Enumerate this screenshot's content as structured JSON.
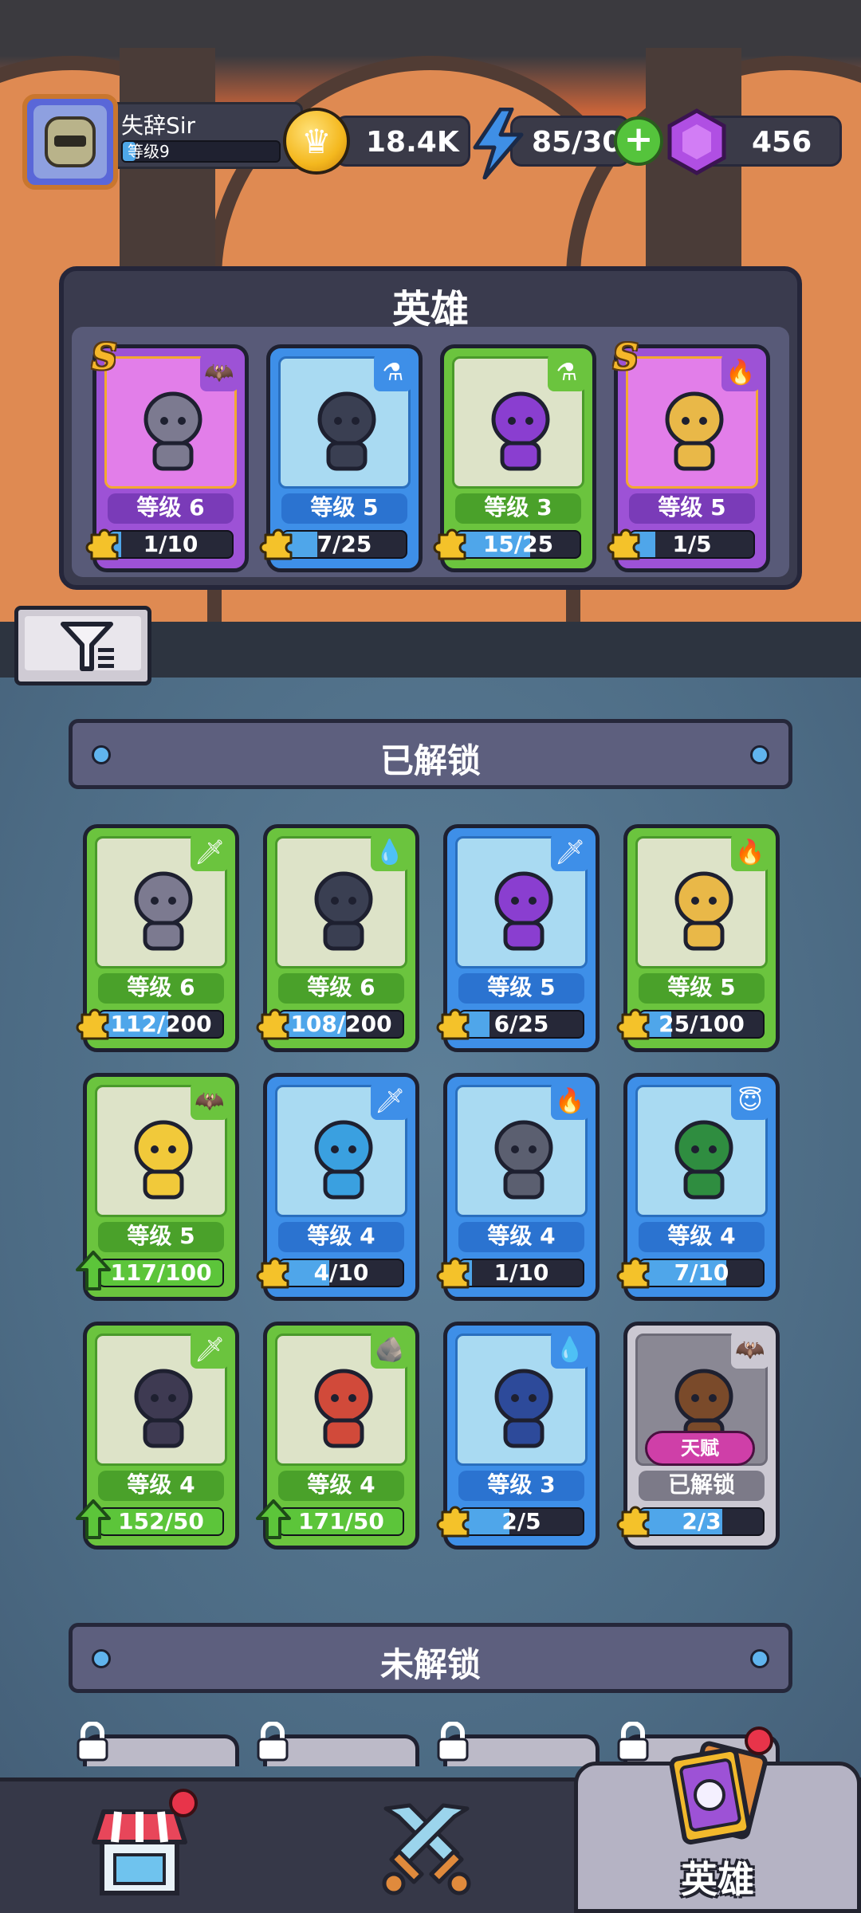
{
  "player": {
    "name": "失辞Sir",
    "level_label": "等级9"
  },
  "currencies": {
    "coins": "18.4K",
    "energy": "85/30",
    "gems": "456"
  },
  "heroes_panel": {
    "title": "英雄",
    "cards": [
      {
        "color": "purple",
        "element": "bat",
        "rank": "S",
        "level": "等级 6",
        "progress": "1/10",
        "fill": 0.1
      },
      {
        "color": "blue",
        "element": "potion",
        "rank": "",
        "level": "等级 5",
        "progress": "7/25",
        "fill": 0.28
      },
      {
        "color": "green",
        "element": "potion",
        "rank": "",
        "level": "等级 3",
        "progress": "15/25",
        "fill": 0.6
      },
      {
        "color": "purple",
        "element": "fire",
        "rank": "S",
        "level": "等级 5",
        "progress": "1/5",
        "fill": 0.2
      }
    ]
  },
  "unlocked": {
    "title": "已解锁",
    "cards": [
      {
        "color": "green",
        "element": "sword",
        "level": "等级 6",
        "progress": "112/200",
        "fill": 0.56
      },
      {
        "color": "green",
        "element": "water",
        "level": "等级 6",
        "progress": "108/200",
        "fill": 0.54
      },
      {
        "color": "blue",
        "element": "sword",
        "level": "等级 5",
        "progress": "6/25",
        "fill": 0.24
      },
      {
        "color": "green",
        "element": "fire",
        "level": "等级 5",
        "progress": "25/100",
        "fill": 0.25
      },
      {
        "color": "green",
        "element": "bat",
        "level": "等级 5",
        "progress": "117/100",
        "fill": 1.0,
        "upgrade": true
      },
      {
        "color": "blue",
        "element": "sword",
        "level": "等级 4",
        "progress": "4/10",
        "fill": 0.4
      },
      {
        "color": "blue",
        "element": "fire",
        "level": "等级 4",
        "progress": "1/10",
        "fill": 0.1
      },
      {
        "color": "blue",
        "element": "wings",
        "level": "等级 4",
        "progress": "7/10",
        "fill": 0.7
      },
      {
        "color": "green",
        "element": "sword",
        "level": "等级 4",
        "progress": "152/50",
        "fill": 1.0,
        "upgrade": true
      },
      {
        "color": "green",
        "element": "rock",
        "level": "等级 4",
        "progress": "171/50",
        "fill": 1.0,
        "upgrade": true
      },
      {
        "color": "blue",
        "element": "water",
        "level": "等级 3",
        "progress": "2/5",
        "fill": 0.4
      },
      {
        "color": "gray",
        "element": "bat",
        "level": "已解锁",
        "progress": "2/3",
        "fill": 0.67,
        "talent": "天赋"
      }
    ]
  },
  "locked": {
    "title": "未解锁"
  },
  "nav": {
    "active_label": "英雄"
  },
  "colors": {
    "gold": "#f4b81e",
    "energy": "#3f8fe6",
    "gem": "#b04fe3",
    "green": "#6bc43e",
    "blue": "#3e8fe8",
    "purple": "#9d52d6"
  }
}
